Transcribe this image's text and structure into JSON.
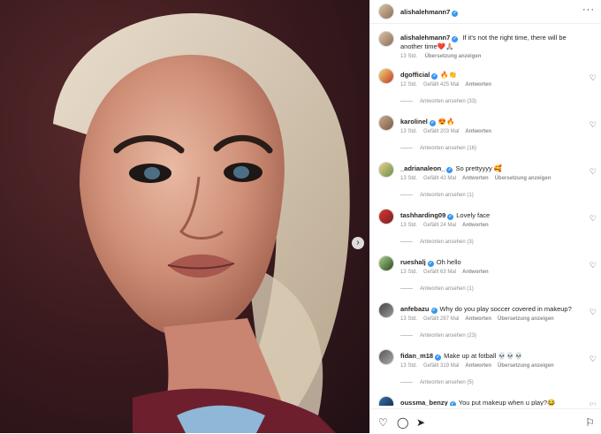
{
  "post": {
    "username": "alishalehmann7",
    "caption": "If it's not the right time, there will be another time❤️🙏🏼",
    "time": "13 Std.",
    "translate": "Übersetzung anzeigen"
  },
  "labels": {
    "reply": "Antworten",
    "translate": "Übersetzung anzeigen"
  },
  "comments": [
    {
      "user": "dgofficial",
      "text": "🔥👏",
      "time": "12 Std.",
      "likes": "Gefällt 425 Mal",
      "replies": "Antworten ansehen (33)",
      "translate": ""
    },
    {
      "user": "karolinel",
      "text": "😍🔥",
      "time": "13 Std.",
      "likes": "Gefällt 203 Mal",
      "replies": "Antworten ansehen (16)",
      "translate": ""
    },
    {
      "user": "_adrianaleon_",
      "text": "So prettyyyy 🥰",
      "time": "13 Std.",
      "likes": "Gefällt 43 Mal",
      "replies": "Antworten ansehen (1)",
      "translate": "Übersetzung anzeigen"
    },
    {
      "user": "tashharding09",
      "text": "Lovely face",
      "time": "13 Std.",
      "likes": "Gefällt 24 Mal",
      "replies": "Antworten ansehen (3)",
      "translate": ""
    },
    {
      "user": "rueshalj",
      "text": "Oh hello",
      "time": "13 Std.",
      "likes": "Gefällt 63 Mal",
      "replies": "Antworten ansehen (1)",
      "translate": ""
    },
    {
      "user": "anfebazu",
      "text": "Why do you play soccer covered in makeup?",
      "time": "13 Std.",
      "likes": "Gefällt 297 Mal",
      "replies": "Antworten ansehen (23)",
      "translate": "Übersetzung anzeigen"
    },
    {
      "user": "fidan_m18",
      "text": "Make up at fotball 💀💀💀",
      "time": "13 Std.",
      "likes": "Gefällt 319 Mal",
      "replies": "Antworten ansehen (5)",
      "translate": "Übersetzung anzeigen"
    },
    {
      "user": "oussma_benzy",
      "text": "You put makeup when u play?😂",
      "time": "",
      "likes": "",
      "replies": "",
      "translate": ""
    }
  ],
  "icons": {
    "verified": "verified-badge-icon",
    "more": "more-options-icon",
    "heart": "heart-icon",
    "comment": "comment-icon",
    "share": "share-icon",
    "save": "bookmark-icon",
    "next": "next-arrow-icon"
  },
  "colors": {
    "verified": "#3897f0",
    "muted": "#8e8e8e"
  }
}
